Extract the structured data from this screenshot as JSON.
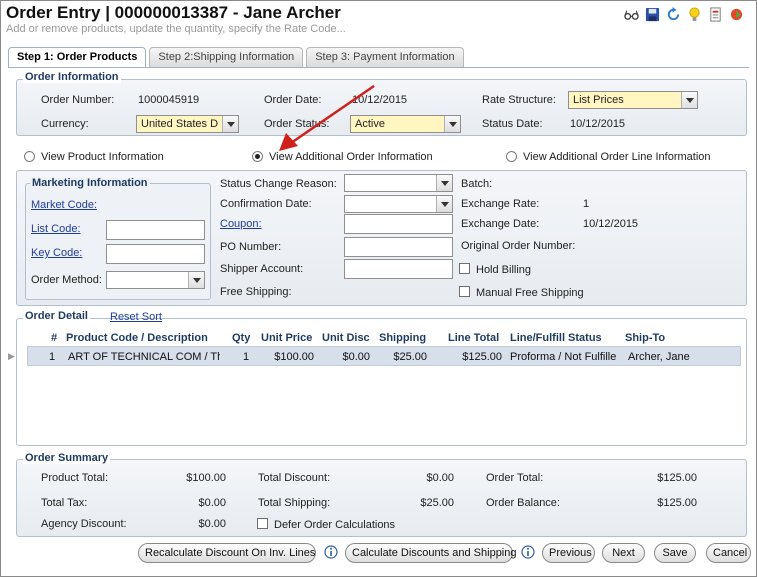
{
  "header": {
    "title": "Order Entry | 000000013387 - Jane Archer",
    "subtitle": "Add or remove products, update the quantity, specify the Rate Code..."
  },
  "toolbar": {
    "icons": [
      "glasses-icon",
      "save-icon",
      "refresh-icon",
      "lightbulb-icon",
      "report-icon",
      "alert-icon"
    ]
  },
  "tabs": [
    {
      "label": "Step 1: Order Products",
      "active": true
    },
    {
      "label": "Step 2:Shipping Information",
      "active": false
    },
    {
      "label": "Step 3: Payment Information",
      "active": false
    }
  ],
  "order_info": {
    "legend": "Order Information",
    "order_number_label": "Order Number:",
    "order_number": "1000045919",
    "order_date_label": "Order Date:",
    "order_date": "10/12/2015",
    "rate_structure_label": "Rate Structure:",
    "rate_structure": "List Prices",
    "currency_label": "Currency:",
    "currency": "United States D",
    "order_status_label": "Order Status:",
    "order_status": "Active",
    "status_date_label": "Status Date:",
    "status_date": "10/12/2015"
  },
  "view_options": {
    "product": "View Product Information",
    "additional_order": "View Additional Order Information",
    "additional_line": "View Additional Order Line Information"
  },
  "marketing": {
    "legend": "Marketing Information",
    "market_code": "Market Code:",
    "list_code": "List Code:",
    "key_code": "Key Code:",
    "order_method": "Order Method:"
  },
  "additional": {
    "status_change_reason": "Status Change Reason:",
    "confirmation_date": "Confirmation Date:",
    "coupon": "Coupon:",
    "po_number": "PO Number:",
    "shipper_account": "Shipper Account:",
    "free_shipping": "Free Shipping:",
    "batch": "Batch:",
    "exchange_rate_label": "Exchange Rate:",
    "exchange_rate": "1",
    "exchange_date_label": "Exchange Date:",
    "exchange_date": "10/12/2015",
    "original_order_number": "Original Order Number:",
    "hold_billing": "Hold Billing",
    "manual_free_shipping": "Manual Free Shipping"
  },
  "order_detail": {
    "legend": "Order Detail",
    "reset_sort": "Reset Sort",
    "columns": [
      "#",
      "Product Code / Description",
      "Qty",
      "Unit Price",
      "Unit Disc",
      "Shipping",
      "Line Total",
      "Line/Fulfill Status",
      "Ship-To"
    ],
    "rows": [
      {
        "num": "1",
        "product": "ART OF TECHNICAL COM / Th",
        "qty": "1",
        "unit_price": "$100.00",
        "unit_disc": "$0.00",
        "shipping": "$25.00",
        "line_total": "$125.00",
        "status": "Proforma / Not Fulfille",
        "ship_to": "Archer, Jane"
      }
    ]
  },
  "summary": {
    "legend": "Order Summary",
    "product_total_label": "Product Total:",
    "product_total": "$100.00",
    "total_discount_label": "Total Discount:",
    "total_discount": "$0.00",
    "order_total_label": "Order Total:",
    "order_total": "$125.00",
    "total_tax_label": "Total Tax:",
    "total_tax": "$0.00",
    "total_shipping_label": "Total Shipping:",
    "total_shipping": "$25.00",
    "order_balance_label": "Order Balance:",
    "order_balance": "$125.00",
    "agency_discount_label": "Agency Discount:",
    "agency_discount": "$0.00",
    "defer": "Defer Order Calculations"
  },
  "buttons": {
    "recalc": "Recalculate Discount On Inv. Lines",
    "calc": "Calculate Discounts and Shipping",
    "previous": "Previous",
    "next": "Next",
    "save": "Save",
    "cancel": "Cancel"
  },
  "colors": {
    "accent": "#1e3a5f",
    "highlight_field": "#fff6c2",
    "arrow": "#d0201c"
  }
}
